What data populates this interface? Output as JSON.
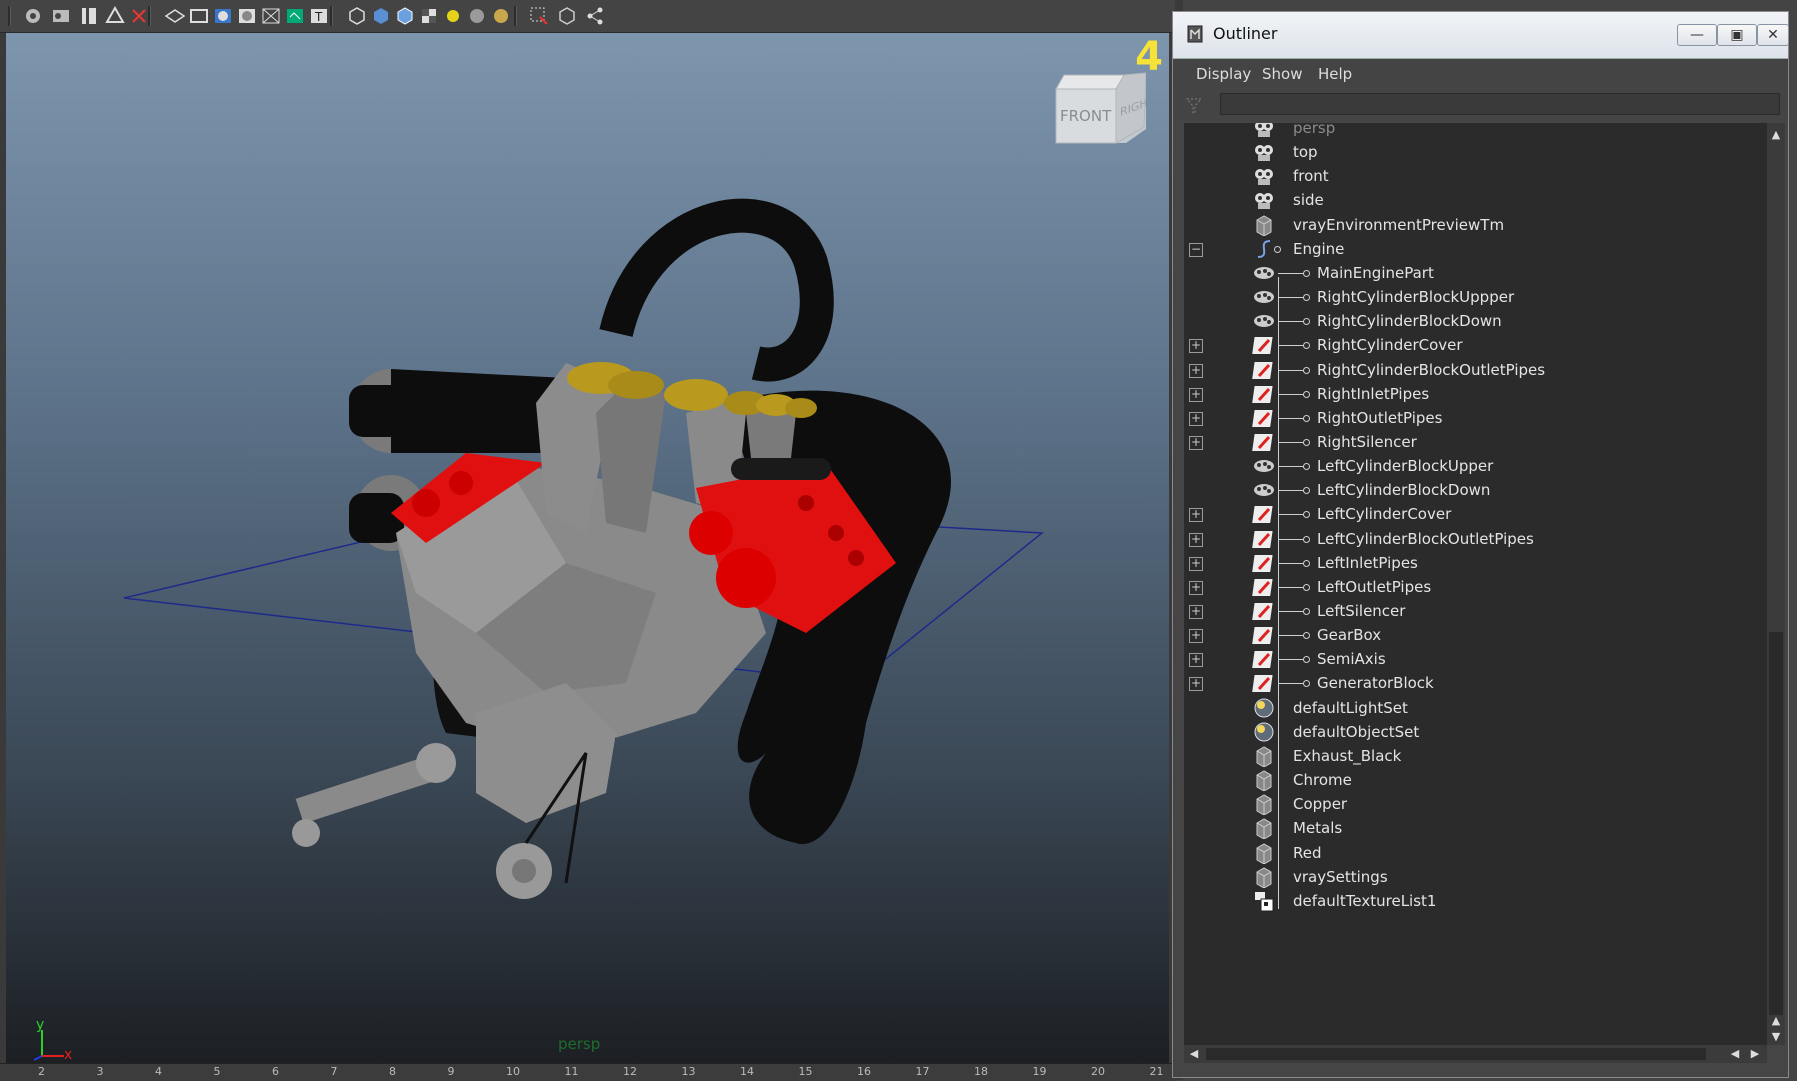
{
  "viewport": {
    "hud_number": "4",
    "camera_label": "persp",
    "viewcube": {
      "front_label": "FRONT",
      "right_label": "RIGHT"
    },
    "axis": {
      "y": "y",
      "x": "x"
    },
    "toolbar_icons": [
      "select-camera-icon",
      "camera-attributes-icon",
      "bookmark-icon",
      "image-plane-icon",
      "two-d-pan-zoom-icon",
      "grid-icon",
      "film-gate-icon",
      "resolution-gate-icon",
      "gate-mask-icon",
      "field-chart-icon",
      "safe-title-icon",
      "wireframe-icon",
      "smooth-shade-icon",
      "wireframe-on-shaded-icon",
      "textured-icon",
      "default-light-icon",
      "shadows-icon",
      "ambient-occlusion-icon",
      "isolate-select-icon",
      "xray-icon",
      "xray-joints-icon",
      "share-icon"
    ],
    "timeline_ticks": [
      "2",
      "3",
      "4",
      "5",
      "6",
      "7",
      "8",
      "9",
      "10",
      "11",
      "12",
      "13",
      "14",
      "15",
      "16",
      "17",
      "18",
      "19",
      "20",
      "21"
    ]
  },
  "outliner": {
    "title": "Outliner",
    "menu": [
      "Display",
      "Show",
      "Help"
    ],
    "filter": {
      "value": "",
      "placeholder": ""
    },
    "items": [
      {
        "label": "persp",
        "icon": "camera-icon",
        "depth": 0,
        "dim": true,
        "expander": ""
      },
      {
        "label": "top",
        "icon": "camera-icon",
        "depth": 0,
        "dim": false,
        "expander": ""
      },
      {
        "label": "front",
        "icon": "camera-icon",
        "depth": 0,
        "dim": false,
        "expander": ""
      },
      {
        "label": "side",
        "icon": "camera-icon",
        "depth": 0,
        "dim": false,
        "expander": ""
      },
      {
        "label": "vrayEnvironmentPreviewTm",
        "icon": "set-icon",
        "depth": 0,
        "dim": false,
        "expander": ""
      },
      {
        "label": "Engine",
        "icon": "curve-icon",
        "depth": 0,
        "dim": false,
        "expander": "−"
      },
      {
        "label": "MainEnginePart",
        "icon": "group-icon",
        "depth": 1,
        "dim": false,
        "expander": ""
      },
      {
        "label": "RightCylinderBlockUppper",
        "icon": "group-icon",
        "depth": 1,
        "dim": false,
        "expander": ""
      },
      {
        "label": "RightCylinderBlockDown",
        "icon": "group-icon",
        "depth": 1,
        "dim": false,
        "expander": ""
      },
      {
        "label": "RightCylinderCover",
        "icon": "mesh-icon",
        "depth": 1,
        "dim": false,
        "expander": "+"
      },
      {
        "label": "RightCylinderBlockOutletPipes",
        "icon": "mesh-icon",
        "depth": 1,
        "dim": false,
        "expander": "+"
      },
      {
        "label": "RightInletPipes",
        "icon": "mesh-icon",
        "depth": 1,
        "dim": false,
        "expander": "+"
      },
      {
        "label": "RightOutletPipes",
        "icon": "mesh-icon",
        "depth": 1,
        "dim": false,
        "expander": "+"
      },
      {
        "label": "RightSilencer",
        "icon": "mesh-icon",
        "depth": 1,
        "dim": false,
        "expander": "+"
      },
      {
        "label": "LeftCylinderBlockUpper",
        "icon": "group-icon",
        "depth": 1,
        "dim": false,
        "expander": ""
      },
      {
        "label": "LeftCylinderBlockDown",
        "icon": "group-icon",
        "depth": 1,
        "dim": false,
        "expander": ""
      },
      {
        "label": "LeftCylinderCover",
        "icon": "mesh-icon",
        "depth": 1,
        "dim": false,
        "expander": "+"
      },
      {
        "label": "LeftCylinderBlockOutletPipes",
        "icon": "mesh-icon",
        "depth": 1,
        "dim": false,
        "expander": "+"
      },
      {
        "label": "LeftInletPipes",
        "icon": "mesh-icon",
        "depth": 1,
        "dim": false,
        "expander": "+"
      },
      {
        "label": "LeftOutletPipes",
        "icon": "mesh-icon",
        "depth": 1,
        "dim": false,
        "expander": "+"
      },
      {
        "label": "LeftSilencer",
        "icon": "mesh-icon",
        "depth": 1,
        "dim": false,
        "expander": "+"
      },
      {
        "label": "GearBox",
        "icon": "mesh-icon",
        "depth": 1,
        "dim": false,
        "expander": "+"
      },
      {
        "label": "SemiAxis",
        "icon": "mesh-icon",
        "depth": 1,
        "dim": false,
        "expander": "+"
      },
      {
        "label": "GeneratorBlock",
        "icon": "mesh-icon",
        "depth": 1,
        "dim": false,
        "expander": "+"
      },
      {
        "label": "defaultLightSet",
        "icon": "light-set-icon",
        "depth": 0,
        "dim": false,
        "expander": ""
      },
      {
        "label": "defaultObjectSet",
        "icon": "light-set-icon",
        "depth": 0,
        "dim": false,
        "expander": ""
      },
      {
        "label": "Exhaust_Black",
        "icon": "set-icon",
        "depth": 0,
        "dim": false,
        "expander": ""
      },
      {
        "label": "Chrome",
        "icon": "set-icon",
        "depth": 0,
        "dim": false,
        "expander": ""
      },
      {
        "label": "Copper",
        "icon": "set-icon",
        "depth": 0,
        "dim": false,
        "expander": ""
      },
      {
        "label": "Metals",
        "icon": "set-icon",
        "depth": 0,
        "dim": false,
        "expander": ""
      },
      {
        "label": "Red",
        "icon": "set-icon",
        "depth": 0,
        "dim": false,
        "expander": ""
      },
      {
        "label": "vraySettings",
        "icon": "set-icon",
        "depth": 0,
        "dim": false,
        "expander": ""
      },
      {
        "label": "defaultTextureList1",
        "icon": "texture-list-icon",
        "depth": 0,
        "dim": false,
        "expander": ""
      }
    ]
  },
  "colors": {
    "hud_yellow": "#f7e23a",
    "engine_red": "#e01010",
    "intake_gold": "#b99a1e",
    "pipe_black": "#0d0d0d",
    "block_gray": "#8f8f8f"
  }
}
